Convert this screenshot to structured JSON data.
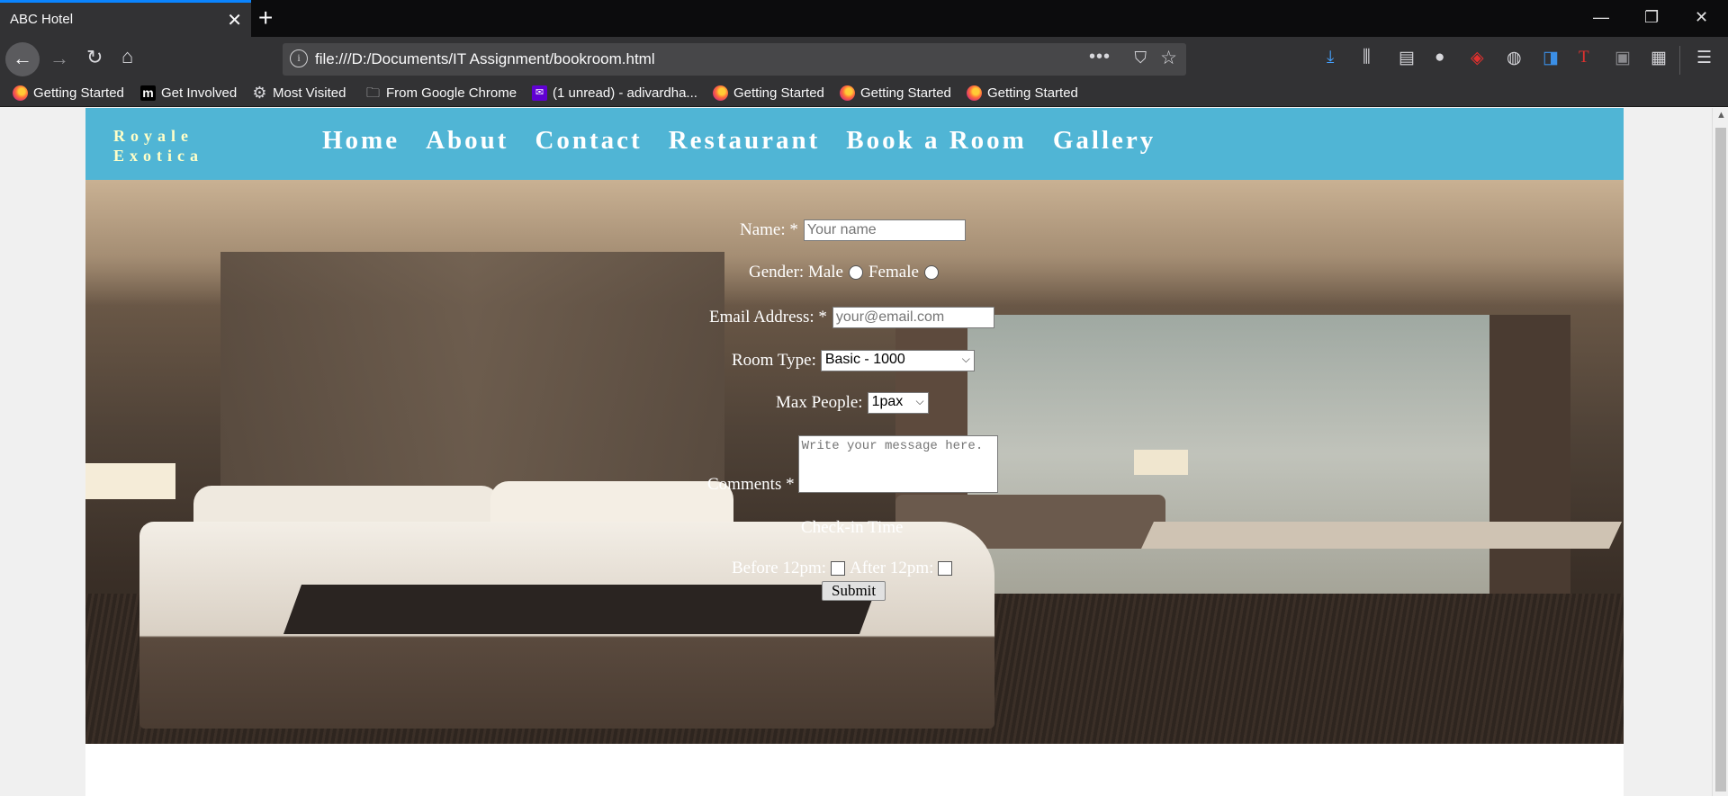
{
  "browser": {
    "tab_title": "ABC Hotel",
    "tab_close": "✕",
    "new_tab": "+",
    "window_controls": {
      "minimize": "—",
      "restore": "❐",
      "close": "✕"
    },
    "nav": {
      "back": "←",
      "forward": "→",
      "reload": "↻",
      "home": "⌂"
    },
    "url": "file:///D:/Documents/IT Assignment/bookroom.html",
    "url_icons": {
      "info": "i",
      "more": "•••",
      "pocket": "⛉",
      "bookmark": "☆"
    },
    "toolbar_icons": {
      "download": "⤓",
      "library": "⫼",
      "sidebar": "▤",
      "account": "●",
      "ublock": "◈",
      "globe": "◍",
      "extension1": "◨",
      "extension2": "T",
      "extension3": "▣",
      "extension4": "▦",
      "menu": "☰"
    },
    "bookmarks": [
      {
        "label": "Getting Started",
        "icon": "firefox-icon"
      },
      {
        "label": "Get Involved",
        "icon": "m-icon",
        "glyph": "m"
      },
      {
        "label": "Most Visited",
        "icon": "gear-icon",
        "glyph": "⚙"
      },
      {
        "label": "From Google Chrome",
        "icon": "folder-icon",
        "glyph": "🗀"
      },
      {
        "label": "(1 unread) - adivardha...",
        "icon": "yahoo-mail-icon",
        "glyph": "✉"
      },
      {
        "label": "Getting Started",
        "icon": "firefox-icon"
      },
      {
        "label": "Getting Started",
        "icon": "firefox-icon"
      },
      {
        "label": "Getting Started",
        "icon": "firefox-icon"
      }
    ],
    "scroll_up": "▲"
  },
  "site": {
    "logo_line1": "Royale",
    "logo_line2": "Exotica",
    "menu": [
      "Home",
      "About",
      "Contact",
      "Restaurant",
      "Book a Room",
      "Gallery"
    ],
    "colors": {
      "header_bg": "#50b5d5",
      "logo_text": "#ffffc8",
      "menu_text": "#ffffff"
    }
  },
  "form": {
    "name_label": "Name: *",
    "name_placeholder": "Your name",
    "gender_label": "Gender: Male",
    "gender_female": "Female",
    "email_label": "Email Address: *",
    "email_placeholder": "your@email.com",
    "room_type_label": "Room Type:",
    "room_type_value": "Basic - 1000",
    "max_people_label": "Max People:",
    "max_people_value": "1pax",
    "comments_label": "Comments *",
    "comments_placeholder": "Write your message here.",
    "checkin_heading": "Check-in Time",
    "before_label": "Before 12pm:",
    "after_label": "After 12pm:",
    "submit_label": "Submit",
    "select_arrow": "⌵"
  }
}
